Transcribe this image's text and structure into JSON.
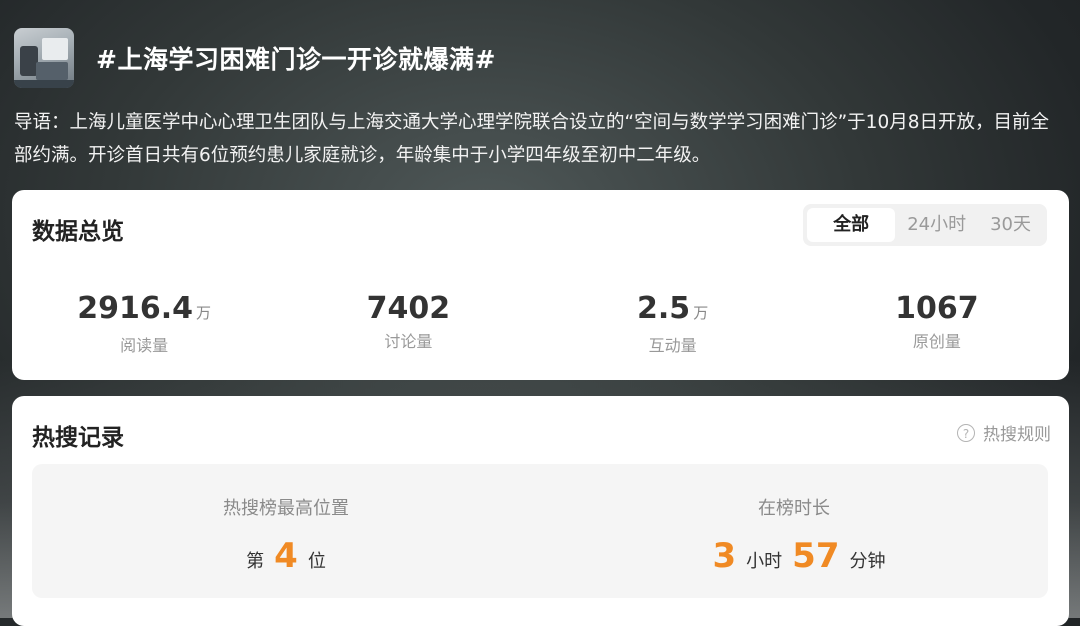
{
  "header": {
    "title": "#上海学习困难门诊一开诊就爆满#",
    "lead": "导语：上海儿童医学中心心理卫生团队与上海交通大学心理学院联合设立的“空间与数学学习困难门诊”于10月8日开放，目前全部约满。开诊首日共有6位预约患儿家庭就诊，年龄集中于小学四年级至初中二年级。"
  },
  "overview": {
    "title": "数据总览",
    "tabs": [
      "全部",
      "24小时",
      "30天"
    ],
    "selected_tab": "全部",
    "stats": [
      {
        "value": "2916.4",
        "unit": "万",
        "label": "阅读量"
      },
      {
        "value": "7402",
        "unit": "",
        "label": "讨论量"
      },
      {
        "value": "2.5",
        "unit": "万",
        "label": "互动量"
      },
      {
        "value": "1067",
        "unit": "",
        "label": "原创量"
      }
    ]
  },
  "hot_record": {
    "title": "热搜记录",
    "rules_label": "热搜规则",
    "rules_icon": "question-circle-icon",
    "highest_position": {
      "label": "热搜榜最高位置",
      "prefix": "第",
      "value": "4",
      "suffix": "位"
    },
    "duration": {
      "label": "在榜时长",
      "hours": "3",
      "hours_unit": "小时",
      "minutes": "57",
      "minutes_unit": "分钟"
    }
  },
  "colors": {
    "accent": "#f08a24",
    "card_bg": "#ffffff",
    "panel_bg": "#f5f5f5"
  }
}
